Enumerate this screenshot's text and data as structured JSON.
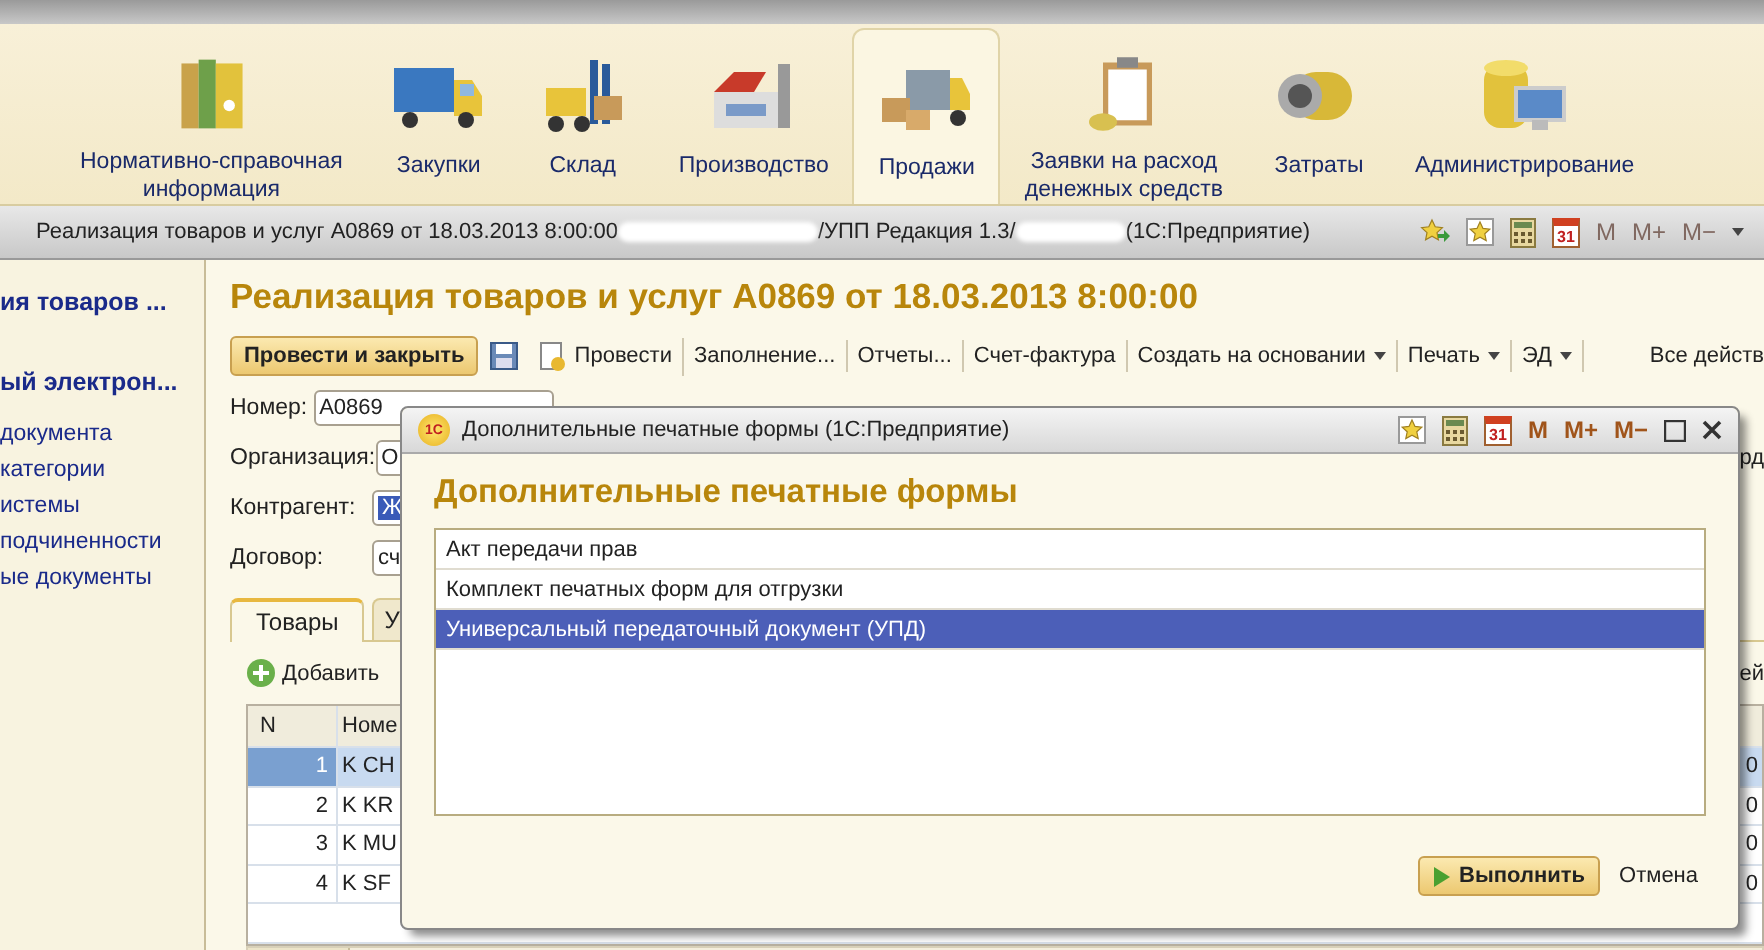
{
  "sections": [
    {
      "label": "Нормативно-справочная\nинформация",
      "selected": false
    },
    {
      "label": "Закупки",
      "selected": false
    },
    {
      "label": "Склад",
      "selected": false
    },
    {
      "label": "Производство",
      "selected": false
    },
    {
      "label": "Продажи",
      "selected": true
    },
    {
      "label": "Заявки на расход\nденежных средств",
      "selected": false
    },
    {
      "label": "Затраты",
      "selected": false
    },
    {
      "label": "Администрирование",
      "selected": false
    }
  ],
  "address_bar": {
    "parts": [
      {
        "kind": "text",
        "text": "Реализация товаров и услуг А0869 от 18.03.2013 8:00:00"
      },
      {
        "kind": "redacted"
      },
      {
        "kind": "text",
        "text": "/УПП Редакция 1.3/"
      },
      {
        "kind": "redacted"
      },
      {
        "kind": "text",
        "text": "(1С:Предприятие)"
      }
    ],
    "calendar_day": "31",
    "memory_keys": [
      "M",
      "M+",
      "M−"
    ],
    "memory_disabled": true
  },
  "left_panel": {
    "items": [
      {
        "text": "ия товаров ...",
        "bold": true
      },
      {
        "text": "ый электрон...",
        "bold": true
      },
      {
        "text": "документа",
        "bold": false
      },
      {
        "text": "категории",
        "bold": false
      },
      {
        "text": "истемы",
        "bold": false
      },
      {
        "text": "подчиненности",
        "bold": false
      },
      {
        "text": "ые документы",
        "bold": false
      }
    ]
  },
  "form": {
    "title": "Реализация товаров и услуг А0869 от 18.03.2013 8:00:00",
    "toolbar": [
      {
        "kind": "primary",
        "label": "Провести и закрыть"
      },
      {
        "kind": "save"
      },
      {
        "kind": "post",
        "label": "Провести"
      },
      {
        "kind": "button",
        "label": "Заполнение..."
      },
      {
        "kind": "button",
        "label": "Отчеты..."
      },
      {
        "kind": "button",
        "label": "Счет-фактура"
      },
      {
        "kind": "dropdown",
        "label": "Создать на основании"
      },
      {
        "kind": "dropdown",
        "label": "Печать"
      },
      {
        "kind": "dropdown",
        "label": "ЭД"
      },
      {
        "kind": "more",
        "label": "Все действ"
      }
    ],
    "fields": [
      {
        "label": "Номер:",
        "value": "А0869",
        "highlighted": false
      },
      {
        "label": "Организация:",
        "value": "О",
        "highlighted": false,
        "right_text": "рд"
      },
      {
        "label": "Контрагент:",
        "value": "Ж",
        "highlighted": true
      },
      {
        "label": "Договор:",
        "value": "сч",
        "highlighted": false
      }
    ],
    "tabs": [
      {
        "label": "Товары",
        "selected": true
      },
      {
        "label": "У",
        "selected": false
      }
    ],
    "add_button": "Добавить",
    "add_right_text": "ей",
    "table": {
      "columns": [
        "N",
        "Номе"
      ],
      "rows": [
        {
          "n": "1",
          "name": "K CH",
          "tail": "0",
          "selected": true
        },
        {
          "n": "2",
          "name": "K KR",
          "tail": "0",
          "selected": false
        },
        {
          "n": "3",
          "name": "K MU",
          "tail": "0",
          "selected": false
        },
        {
          "n": "4",
          "name": "K SF",
          "tail": "0",
          "selected": false
        }
      ]
    }
  },
  "dialog": {
    "logo": "1С",
    "title": "Дополнительные печатные формы  (1С:Предприятие)",
    "calendar_day": "31",
    "memory_keys": [
      "M",
      "M+",
      "M−"
    ],
    "heading": "Дополнительные печатные формы",
    "items": [
      {
        "label": "Акт передачи прав",
        "selected": false
      },
      {
        "label": "Комплект печатных форм для отгрузки",
        "selected": false
      },
      {
        "label": "Универсальный передаточный документ (УПД)",
        "selected": true
      }
    ],
    "buttons": [
      {
        "kind": "primary",
        "label": "Выполнить"
      },
      {
        "kind": "plain",
        "label": "Отмена"
      }
    ]
  }
}
